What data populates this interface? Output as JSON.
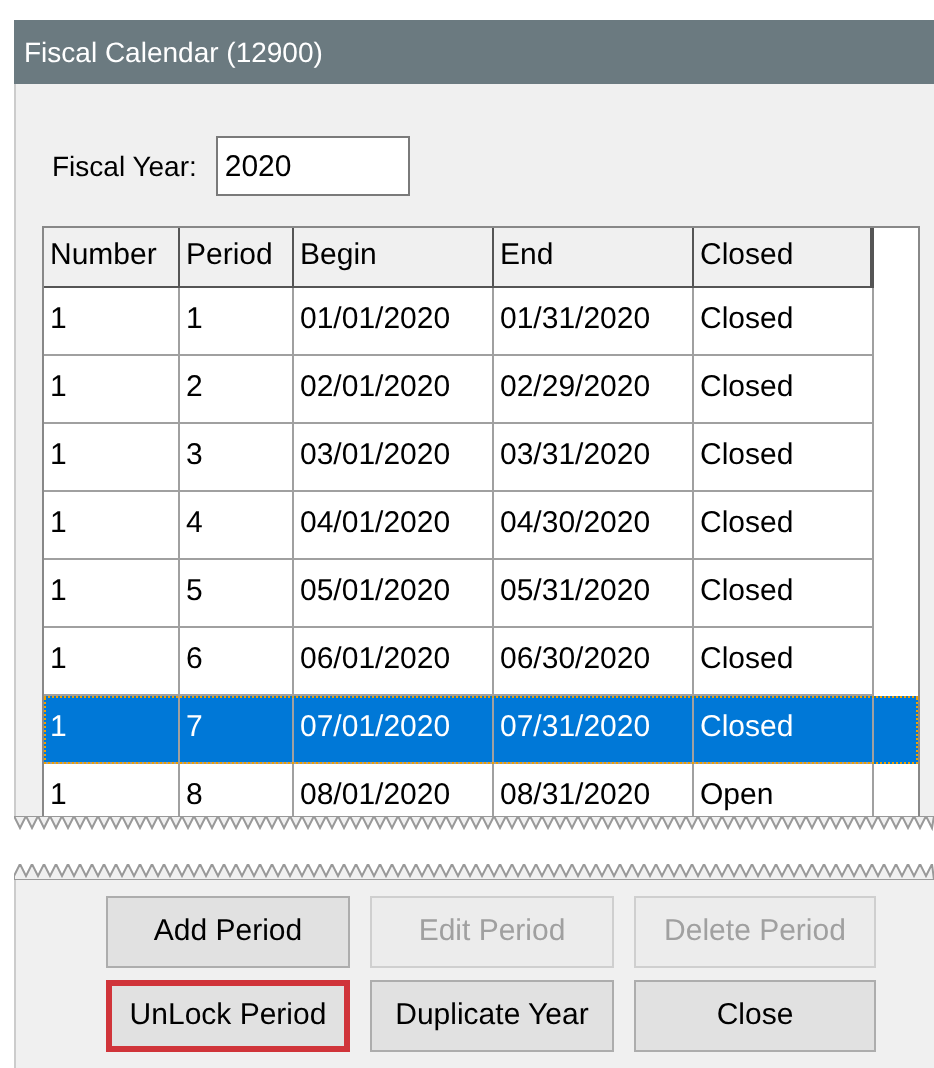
{
  "window": {
    "title": "Fiscal Calendar (12900)"
  },
  "fiscal_year": {
    "label": "Fiscal Year:",
    "value": "2020"
  },
  "table": {
    "columns": [
      "Number",
      "Period",
      "Begin",
      "End",
      "Closed"
    ],
    "rows": [
      {
        "cells": [
          "1",
          "1",
          "01/01/2020",
          "01/31/2020",
          "Closed"
        ],
        "selected": false
      },
      {
        "cells": [
          "1",
          "2",
          "02/01/2020",
          "02/29/2020",
          "Closed"
        ],
        "selected": false
      },
      {
        "cells": [
          "1",
          "3",
          "03/01/2020",
          "03/31/2020",
          "Closed"
        ],
        "selected": false
      },
      {
        "cells": [
          "1",
          "4",
          "04/01/2020",
          "04/30/2020",
          "Closed"
        ],
        "selected": false
      },
      {
        "cells": [
          "1",
          "5",
          "05/01/2020",
          "05/31/2020",
          "Closed"
        ],
        "selected": false
      },
      {
        "cells": [
          "1",
          "6",
          "06/01/2020",
          "06/30/2020",
          "Closed"
        ],
        "selected": false
      },
      {
        "cells": [
          "1",
          "7",
          "07/01/2020",
          "07/31/2020",
          "Closed"
        ],
        "selected": true
      },
      {
        "cells": [
          "1",
          "8",
          "08/01/2020",
          "08/31/2020",
          "Open"
        ],
        "selected": false
      }
    ]
  },
  "buttons": [
    {
      "label": "Add Period",
      "disabled": false,
      "highlighted": false
    },
    {
      "label": "Edit Period",
      "disabled": true,
      "highlighted": false
    },
    {
      "label": "Delete Period",
      "disabled": true,
      "highlighted": false
    },
    {
      "label": "UnLock Period",
      "disabled": false,
      "highlighted": true
    },
    {
      "label": "Duplicate Year",
      "disabled": false,
      "highlighted": false
    },
    {
      "label": "Close",
      "disabled": false,
      "highlighted": false
    }
  ]
}
